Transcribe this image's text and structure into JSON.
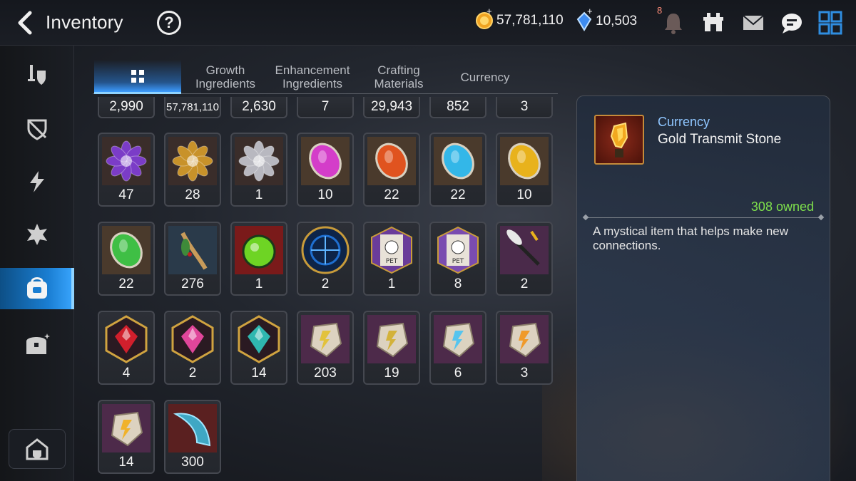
{
  "header": {
    "title": "Inventory",
    "help_label": "?",
    "gold": "57,781,110",
    "crystals": "10,503",
    "notification_count": "8",
    "plus": "+"
  },
  "tabs": [
    {
      "label": "",
      "icon": "grid-icon",
      "active": true
    },
    {
      "label": "Growth\nIngredients"
    },
    {
      "label": "Enhancement\nIngredients"
    },
    {
      "label": "Crafting\nMaterials"
    },
    {
      "label": "Currency"
    }
  ],
  "sidebar": {
    "items": [
      "equipment-icon",
      "artifact-icon",
      "catalyst-icon",
      "rune-icon",
      "bag-icon",
      "chest-icon"
    ],
    "active_index": 4,
    "bottom": "storage-house-icon"
  },
  "top_row_counts": [
    "2,990",
    "57,781,110",
    "2,630",
    "7",
    "29,943",
    "852",
    "3"
  ],
  "items": [
    {
      "count": "47",
      "icon": "purple-flower-icon",
      "color": "#7b3cc7"
    },
    {
      "count": "28",
      "icon": "gold-flower-icon",
      "color": "#c8922a"
    },
    {
      "count": "1",
      "icon": "silver-flower-icon",
      "color": "#b8b8c0"
    },
    {
      "count": "10",
      "icon": "magenta-rune-icon",
      "color": "#d43dc9"
    },
    {
      "count": "22",
      "icon": "orange-rune-icon",
      "color": "#e0531f"
    },
    {
      "count": "22",
      "icon": "cyan-rune-icon",
      "color": "#33b7e8"
    },
    {
      "count": "10",
      "icon": "yellow-rune-icon",
      "color": "#e8b21c"
    },
    {
      "count": "22",
      "icon": "green-rune-icon",
      "color": "#3fbf45"
    },
    {
      "count": "276",
      "icon": "herb-root-icon",
      "color": "#c89b5a"
    },
    {
      "count": "1",
      "icon": "green-potion-icon",
      "color": "#6ed424"
    },
    {
      "count": "2",
      "icon": "blue-portal-icon",
      "color": "#1f6fd0"
    },
    {
      "count": "1",
      "icon": "pet-pack-icon",
      "color": "#6a3c9a"
    },
    {
      "count": "8",
      "icon": "pet-pack-icon",
      "color": "#7a4cb0"
    },
    {
      "count": "2",
      "icon": "feather-staff-icon",
      "color": "#e8e8e8"
    },
    {
      "count": "4",
      "icon": "red-crystal-icon",
      "color": "#d11f2c"
    },
    {
      "count": "2",
      "icon": "pink-elixir-icon",
      "color": "#e0469a"
    },
    {
      "count": "14",
      "icon": "teal-stone-icon",
      "color": "#2fb7b0"
    },
    {
      "count": "203",
      "icon": "yellow-transmit-stone-icon",
      "color": "#e2c23b"
    },
    {
      "count": "19",
      "icon": "yellow-transmit-stone-icon",
      "color": "#d3b23a"
    },
    {
      "count": "6",
      "icon": "blue-transmit-stone-icon",
      "color": "#56c4ee"
    },
    {
      "count": "3",
      "icon": "orange-transmit-stone-icon",
      "color": "#f09a2a"
    },
    {
      "count": "14",
      "icon": "orange-transmit-stone-icon",
      "color": "#f0b22a"
    },
    {
      "count": "300",
      "icon": "claw-icon",
      "color": "#3fa7c4"
    }
  ],
  "detail": {
    "type": "Currency",
    "name": "Gold Transmit Stone",
    "owned": "308 owned",
    "description": "A mystical item that helps make new connections.",
    "icon": "gold-transmit-stone-icon"
  }
}
